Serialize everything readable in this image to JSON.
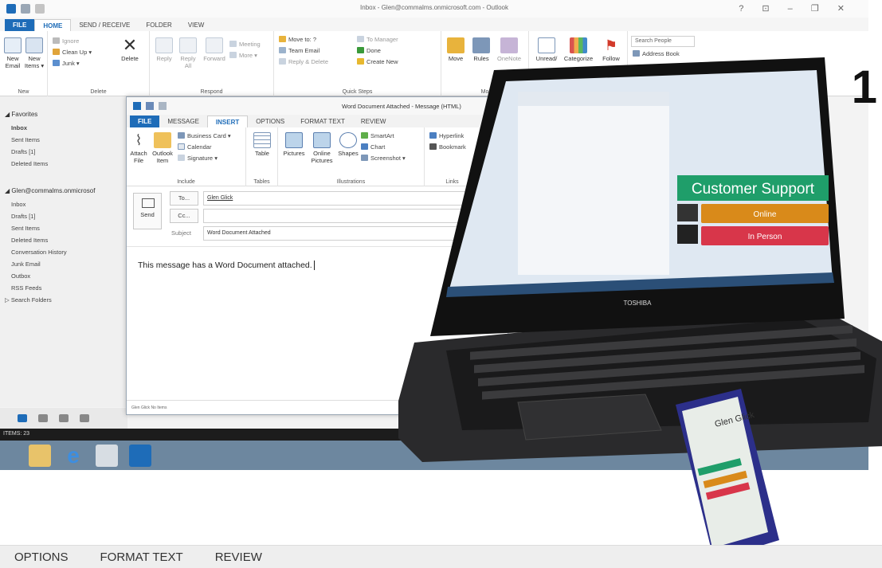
{
  "outlook": {
    "title": "Inbox - Glen@commalms.onmicrosoft.com - Outlook",
    "window_controls": "? ⊡ – ❐ ✕",
    "tabs": [
      "FILE",
      "HOME",
      "SEND / RECEIVE",
      "FOLDER",
      "VIEW"
    ],
    "ribbon": {
      "new": {
        "new_email": "New Email",
        "new_items": "New Items ▾",
        "group": "New"
      },
      "delete": {
        "ignore": "Ignore",
        "clean_up": "Clean Up ▾",
        "junk": "Junk ▾",
        "delete": "Delete",
        "group": "Delete"
      },
      "respond": {
        "reply": "Reply",
        "reply_all": "Reply All",
        "forward": "Forward",
        "meeting": "Meeting",
        "more": "More ▾",
        "group": "Respond"
      },
      "quick_steps": {
        "move_to": "Move to: ?",
        "team_email": "Team Email",
        "reply_delete": "Reply & Delete",
        "to_manager": "To Manager",
        "done": "Done",
        "create_new": "Create New",
        "group": "Quick Steps"
      },
      "move": {
        "move": "Move",
        "rules": "Rules",
        "onenote": "OneNote",
        "group": "Mo"
      },
      "tags": {
        "unread": "Unread/",
        "categorize": "Categorize",
        "follow": "Follow"
      },
      "find": {
        "search_people": "Search People",
        "address_book": "Address Book"
      }
    },
    "nav": {
      "favorites_header": "◢ Favorites",
      "favorites": [
        "Inbox",
        "Sent Items",
        "Drafts [1]",
        "Deleted Items"
      ],
      "account_header": "◢ Glen@commalms.onmicrosof",
      "folders": [
        "Inbox",
        "Drafts [1]",
        "Sent Items",
        "Deleted Items",
        "Conversation History",
        "Junk Email",
        "Outbox",
        "RSS Feeds",
        "▷ Search Folders"
      ]
    },
    "status": "ITEMS: 23"
  },
  "compose": {
    "title": "Word Document Attached - Message (HTML)",
    "tabs": [
      "FILE",
      "MESSAGE",
      "INSERT",
      "OPTIONS",
      "FORMAT TEXT",
      "REVIEW"
    ],
    "ribbon": {
      "include": {
        "attach_file": "Attach File",
        "outlook_item": "Outlook Item",
        "business_card": "Business Card ▾",
        "calendar": "Calendar",
        "signature": "Signature ▾",
        "group": "Include"
      },
      "tables": {
        "table": "Table",
        "group": "Tables"
      },
      "illustrations": {
        "pictures": "Pictures",
        "online_pictures": "Online Pictures",
        "shapes": "Shapes",
        "smartart": "SmartArt",
        "chart": "Chart",
        "screenshot": "Screenshot ▾",
        "group": "Illustrations"
      },
      "links": {
        "hyperlink": "Hyperlink",
        "bookmark": "Bookmark",
        "group": "Links"
      }
    },
    "send": "Send",
    "to_label": "To...",
    "to_value": "Glen Glick",
    "cc_label": "Cc...",
    "cc_value": "",
    "subject_label": "Subject",
    "subject_value": "Word Document Attached",
    "body": "This message has a Word Document attached.",
    "footer": "Glen Glick  No Items"
  },
  "laptop": {
    "brand": "TOSHIBA",
    "screen_banner": "Customer Support",
    "online": "Online",
    "in_person": "In Person"
  },
  "phone": {
    "name": "Glen Glick"
  },
  "step_number": "1",
  "bottom_strip": [
    "OPTIONS",
    "FORMAT TEXT",
    "REVIEW"
  ]
}
